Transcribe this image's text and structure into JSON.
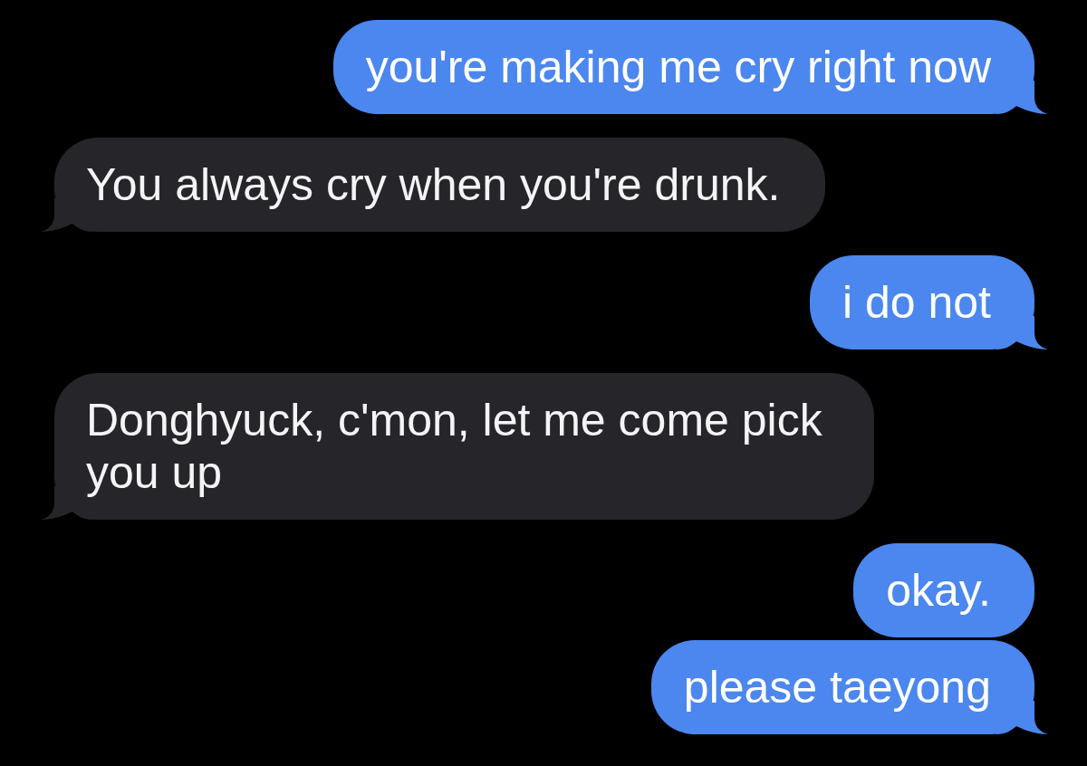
{
  "messages": [
    {
      "kind": "sent",
      "text": "you're making me cry right now",
      "tail": true
    },
    {
      "kind": "received",
      "text": "You always cry when you're drunk.",
      "tail": true
    },
    {
      "kind": "sent",
      "text": "i do not",
      "tail": true
    },
    {
      "kind": "received",
      "text": "Donghyuck, c'mon, let me come pick you up",
      "tail": true
    },
    {
      "kind": "sent",
      "text": "okay.",
      "tail": false
    },
    {
      "kind": "sent",
      "text": "please taeyong",
      "tail": true
    }
  ]
}
